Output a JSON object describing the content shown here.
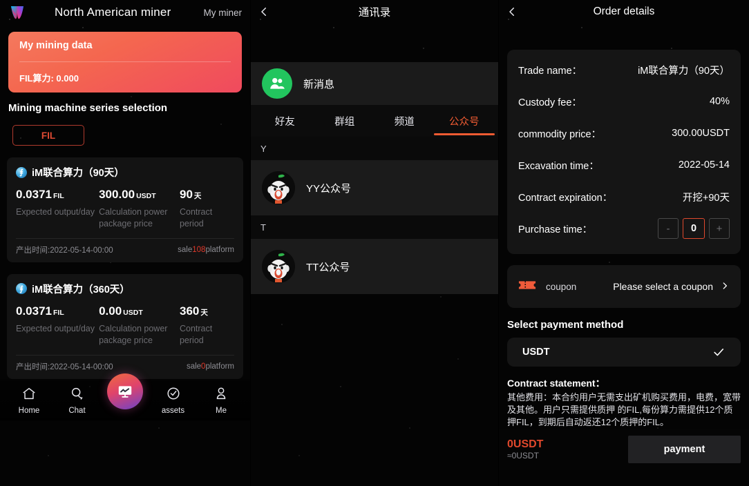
{
  "left": {
    "header": {
      "logo_icon": "app-logo-icon",
      "title": "North American miner",
      "my_miner": "My miner"
    },
    "mining_card": {
      "title": "My mining data",
      "power_label": "FIL算力: 0.000"
    },
    "section_title": "Mining machine series selection",
    "filter": {
      "fil": "FIL"
    },
    "packages": [
      {
        "coin_icon": "filecoin-icon",
        "name": "iM联合算力",
        "duration_label": "（90天）",
        "output_value": "0.0371",
        "output_unit": "FIL",
        "output_label": "Expected output/day",
        "price_value": "300.00",
        "price_unit": "USDT",
        "price_label": "Calculation power package price",
        "period_value": "90",
        "period_unit": "天",
        "period_label": "Contract period",
        "time_label": "产出时间:2022-05-14-00:00",
        "sale_prefix": "sale",
        "sale_count": "108",
        "sale_suffix": "platform"
      },
      {
        "coin_icon": "filecoin-icon",
        "name": "iM联合算力",
        "duration_label": "（360天）",
        "output_value": "0.0371",
        "output_unit": "FIL",
        "output_label": "Expected output/day",
        "price_value": "0.00",
        "price_unit": "USDT",
        "price_label": "Calculation power package price",
        "period_value": "360",
        "period_unit": "天",
        "period_label": "Contract period",
        "time_label": "产出时间:2022-05-14-00:00",
        "sale_prefix": "sale",
        "sale_count": "0",
        "sale_suffix": "platform"
      }
    ],
    "tabbar": [
      {
        "icon": "home-icon",
        "label": "Home"
      },
      {
        "icon": "chat-icon",
        "label": "Chat"
      },
      {
        "icon": "market-monitor-icon",
        "label": ""
      },
      {
        "icon": "assets-check-icon",
        "label": "assets"
      },
      {
        "icon": "person-icon",
        "label": "Me"
      }
    ]
  },
  "mid": {
    "header": {
      "back_icon": "chevron-left-icon",
      "title": "通讯录"
    },
    "new_message": {
      "avatar_icon": "group-people-icon",
      "label": "新消息"
    },
    "tabs": [
      {
        "label": "好友",
        "active": false
      },
      {
        "label": "群组",
        "active": false
      },
      {
        "label": "频道",
        "active": false
      },
      {
        "label": "公众号",
        "active": true
      }
    ],
    "groups": [
      {
        "index": "Y",
        "contacts": [
          {
            "name": "YY公众号",
            "avatar_icon": "cat-face-avatar-icon"
          }
        ]
      },
      {
        "index": "T",
        "contacts": [
          {
            "name": "TT公众号",
            "avatar_icon": "cat-face-avatar-icon"
          }
        ]
      }
    ]
  },
  "right": {
    "header": {
      "back_icon": "chevron-left-icon",
      "title": "Order details"
    },
    "details": [
      {
        "key": "Trade name：",
        "value": "iM联合算力（90天）"
      },
      {
        "key": "Custody fee：",
        "value": "40%"
      },
      {
        "key": "commodity price：",
        "value": "300.00USDT"
      },
      {
        "key": "Excavation time：",
        "value": "2022-05-14"
      },
      {
        "key": "Contract expiration：",
        "value": "开挖+90天"
      }
    ],
    "purchase": {
      "key": "Purchase time：",
      "minus": "-",
      "value": "0",
      "plus": "+"
    },
    "coupon": {
      "icon": "coupon-ticket-icon",
      "label": "coupon",
      "placeholder": "Please select a coupon",
      "chevron": "chevron-right-icon"
    },
    "payment_section": {
      "title": "Select payment method",
      "method": "USDT",
      "check_icon": "check-icon"
    },
    "statement": {
      "title": "Contract statement：",
      "body": "其他费用：本合约用户无需支出矿机购买费用，电费，宽带及其他。用户只需提供质押 的FIL,每份算力需提供12个质押FIL，到期后自动返还12个质押的FIL。"
    },
    "footer": {
      "amount": "0USDT",
      "approx": "≈0USDT",
      "pay_button": "payment"
    }
  },
  "colors": {
    "accent_red": "#e0482c",
    "tab_active": "#ef5b32",
    "card_bg": "#151515",
    "page_bg": "#050505",
    "green_avatar": "#22c55e"
  }
}
